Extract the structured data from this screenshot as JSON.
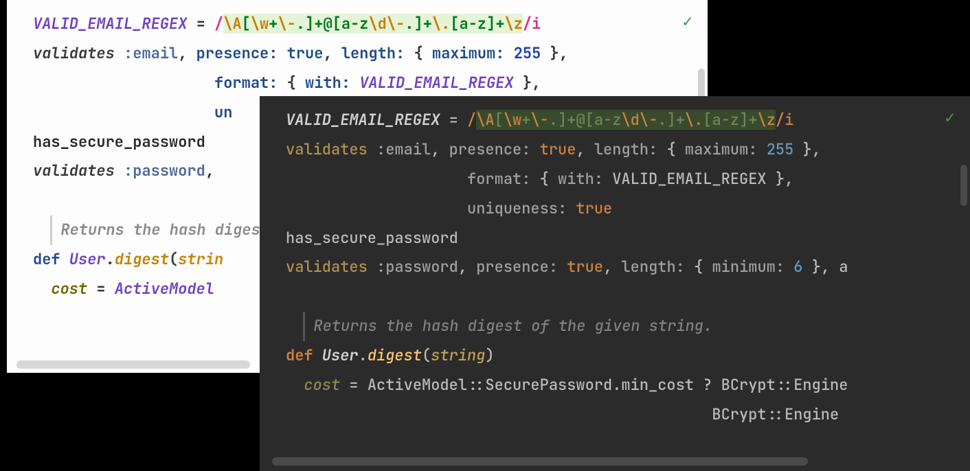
{
  "light": {
    "tokens": {
      "const_name": "VALID_EMAIL_REGEX",
      "eq": " = ",
      "rx_open": "/",
      "rx_A": "\\A",
      "rx_br1": "[",
      "rx_w": "\\w",
      "rx_plus1": "+",
      "rx_dash": "\\-",
      "rx_dot1": ".",
      "rx_br1c": "]",
      "rx_plus2": "+",
      "rx_at": "@",
      "rx_br2": "[",
      "rx_az1": "a-z",
      "rx_d": "\\d",
      "rx_dash2": "\\-",
      "rx_dot2": ".",
      "rx_br2c": "]",
      "rx_plus3": "+",
      "rx_escdot": "\\.",
      "rx_br3": "[",
      "rx_az2": "a-z",
      "rx_br3c": "]",
      "rx_plus4": "+",
      "rx_z": "\\z",
      "rx_close": "/i",
      "validates": "validates",
      "sym_email": " :email",
      "comma": ", ",
      "presence": "presence: ",
      "true": "true",
      "length": "length: ",
      "lbrace": "{ ",
      "maximum": "maximum: ",
      "max_val": "255",
      "rbrace": " }",
      "format": "format: ",
      "with": "with: ",
      "uni_prefix": "un",
      "has_secure": "has_secure_password",
      "sym_password": " :password",
      "comment": "Returns the hash digest",
      "def": "def",
      "class_user": " User",
      "dot": ".",
      "method_digest": "digest",
      "lparen": "(",
      "param_string": "strin",
      "cost": "cost",
      "eq2": " = ",
      "activemodel": "ActiveModel"
    }
  },
  "dark": {
    "tokens": {
      "const_name": "VALID_EMAIL_REGEX",
      "eq": " = ",
      "rx_open": "/",
      "rx_A": "\\A",
      "rx_br1": "[",
      "rx_w": "\\w",
      "rx_plus1": "+",
      "rx_dash": "\\-",
      "rx_dot1": ".",
      "rx_br1c": "]",
      "rx_plus2": "+",
      "rx_at": "@",
      "rx_br2": "[",
      "rx_az1": "a-z",
      "rx_d": "\\d",
      "rx_dash2": "\\-",
      "rx_dot2": ".",
      "rx_br2c": "]",
      "rx_plus3": "+",
      "rx_escdot": "\\.",
      "rx_br3": "[",
      "rx_az2": "a-z",
      "rx_br3c": "]",
      "rx_plus4": "+",
      "rx_z": "\\z",
      "rx_close": "/i",
      "validates": "validates",
      "sym_email": " :email",
      "comma1": ", ",
      "presence": "presence: ",
      "true": "true",
      "length": "length: ",
      "lbrace": "{ ",
      "maximum": "maximum: ",
      "max_val": "255",
      "rbrace": " }",
      "format": "format: ",
      "with": "with: ",
      "uniqueness": "uniqueness: ",
      "has_secure": "has_secure_password",
      "sym_password": " :password",
      "minimum": "minimum: ",
      "min_val": "6",
      "trail_a": "a",
      "comment": "Returns the hash digest of the given string.",
      "def": "def",
      "class_user": " User",
      "dot": ".",
      "method_digest": "digest",
      "lparen": "(",
      "param_string": "string",
      "rparen": ")",
      "cost": "cost",
      "eq2": " = ",
      "activemodel": "ActiveModel",
      "secure_tail": "::SecurePassword.min_cost ? BCrypt::Engine",
      "bcrypt_line": "BCrypt::Engine"
    }
  },
  "icons": {
    "check": "✓"
  }
}
